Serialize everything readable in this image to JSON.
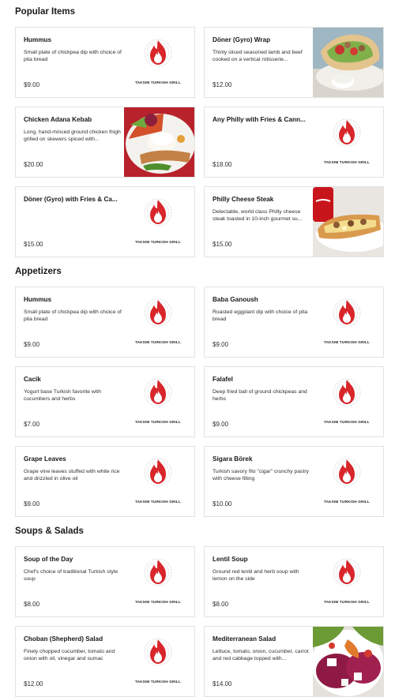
{
  "brand_text": "TAKSIM TURKISH GRILL",
  "colors": {
    "logo_red": "#d8262b",
    "card_border": "#e2e2e2",
    "text": "#191919"
  },
  "sections": [
    {
      "title": "Popular Items",
      "items": [
        {
          "name": "Hummus",
          "desc": "Small plate of chickpea dip with choice of pita bread",
          "price": "$9.00",
          "image": "logo"
        },
        {
          "name": "Döner (Gyro) Wrap",
          "desc": "Thinly sliced seasoned lamb and beef cooked on a vertical rotisserie...",
          "price": "$12.00",
          "image": "wrap-photo"
        },
        {
          "name": "Chicken Adana Kebab",
          "desc": "Long, hand-minced ground chicken thigh grilled on skewers spiced with...",
          "price": "$20.00",
          "image": "kebab-photo"
        },
        {
          "name": "Any Philly with Fries & Cann...",
          "desc": "",
          "price": "$18.00",
          "image": "logo"
        },
        {
          "name": "Döner (Gyro) with Fries & Ca...",
          "desc": "",
          "price": "$15.00",
          "image": "logo"
        },
        {
          "name": "Philly Cheese Steak",
          "desc": "Delectable, world class Philly cheese steak toasted in 10-inch gourmet su...",
          "price": "$15.00",
          "image": "philly-photo"
        }
      ]
    },
    {
      "title": "Appetizers",
      "items": [
        {
          "name": "Hummus",
          "desc": "Small plate of chickpea dip with choice of pita bread",
          "price": "$9.00",
          "image": "logo"
        },
        {
          "name": "Baba Ganoush",
          "desc": "Roasted eggplant dip with choice of pita bread",
          "price": "$9.00",
          "image": "logo"
        },
        {
          "name": "Cacik",
          "desc": "Yogurt base Turkish favorite with cucumbers and herbs",
          "price": "$7.00",
          "image": "logo"
        },
        {
          "name": "Falafel",
          "desc": "Deep fried ball of ground chickpeas and herbs",
          "price": "$9.00",
          "image": "logo"
        },
        {
          "name": "Grape Leaves",
          "desc": "Grape vine leaves stuffed with white rice and drizzled in olive oil",
          "price": "$9.00",
          "image": "logo"
        },
        {
          "name": "Sigara Börek",
          "desc": "Turkish savory filo \"cigar\" crunchy pastry with cheese filling",
          "price": "$10.00",
          "image": "logo"
        }
      ]
    },
    {
      "title": "Soups & Salads",
      "items": [
        {
          "name": "Soup of the Day",
          "desc": "Chef's choice of traditional Turkish style soup",
          "price": "$8.00",
          "image": "logo"
        },
        {
          "name": "Lentil Soup",
          "desc": "Ground red lentil and herb soup with lemon on the side",
          "price": "$8.00",
          "image": "logo"
        },
        {
          "name": "Choban (Shepherd) Salad",
          "desc": "Finely chopped cucumber, tomato and onion with oil, vinegar and sumac",
          "price": "$12.00",
          "image": "logo"
        },
        {
          "name": "Mediterranean Salad",
          "desc": "Lettuce, tomato, onion, cucumber, carrot and red cabbage topped with...",
          "price": "$14.00",
          "image": "salad-photo"
        }
      ]
    }
  ]
}
